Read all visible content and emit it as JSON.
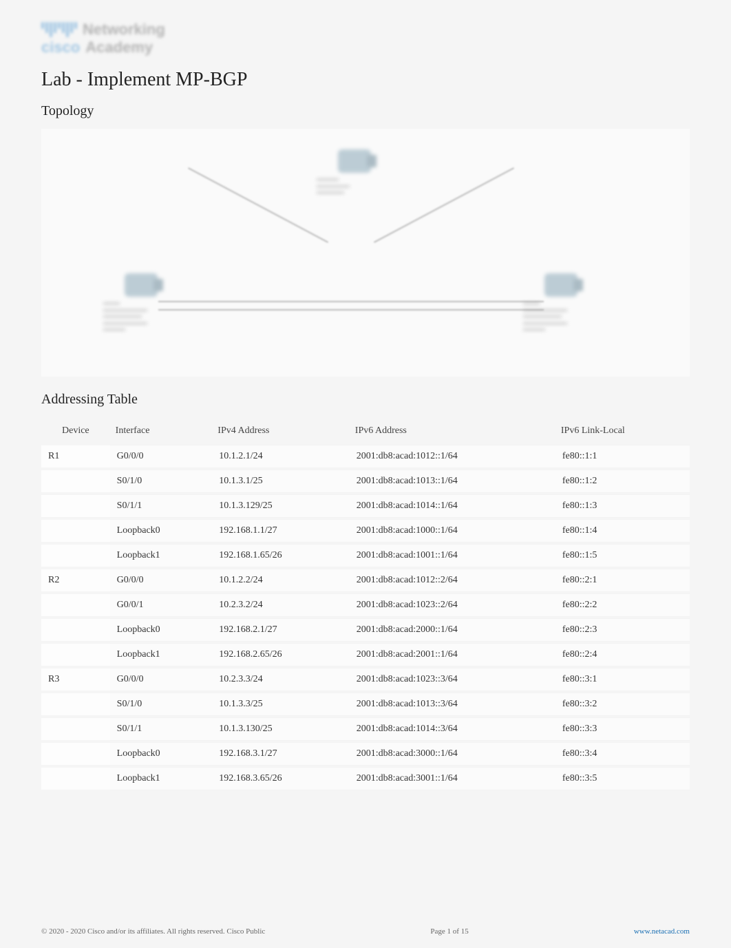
{
  "logo": {
    "brand": "cisco",
    "product_line1": "Networking",
    "product_line2": "Academy"
  },
  "lab_title": "Lab - Implement MP-BGP",
  "sections": {
    "topology": "Topology",
    "addressing_table": "Addressing Table"
  },
  "table": {
    "headers": {
      "device": "Device",
      "interface": "Interface",
      "ipv4": "IPv4 Address",
      "ipv6": "IPv6 Address",
      "ipv6_ll": "IPv6 Link-Local"
    },
    "rows": [
      {
        "device": "R1",
        "interface": "G0/0/0",
        "ipv4": "10.1.2.1/24",
        "ipv6": "2001:db8:acad:1012::1/64",
        "ll": "fe80::1:1"
      },
      {
        "device": "",
        "interface": "S0/1/0",
        "ipv4": "10.1.3.1/25",
        "ipv6": "2001:db8:acad:1013::1/64",
        "ll": "fe80::1:2"
      },
      {
        "device": "",
        "interface": "S0/1/1",
        "ipv4": "10.1.3.129/25",
        "ipv6": "2001:db8:acad:1014::1/64",
        "ll": "fe80::1:3"
      },
      {
        "device": "",
        "interface": "Loopback0",
        "ipv4": "192.168.1.1/27",
        "ipv6": "2001:db8:acad:1000::1/64",
        "ll": "fe80::1:4"
      },
      {
        "device": "",
        "interface": "Loopback1",
        "ipv4": "192.168.1.65/26",
        "ipv6": "2001:db8:acad:1001::1/64",
        "ll": "fe80::1:5"
      },
      {
        "device": "R2",
        "interface": "G0/0/0",
        "ipv4": "10.1.2.2/24",
        "ipv6": "2001:db8:acad:1012::2/64",
        "ll": "fe80::2:1"
      },
      {
        "device": "",
        "interface": "G0/0/1",
        "ipv4": "10.2.3.2/24",
        "ipv6": "2001:db8:acad:1023::2/64",
        "ll": "fe80::2:2"
      },
      {
        "device": "",
        "interface": "Loopback0",
        "ipv4": "192.168.2.1/27",
        "ipv6": "2001:db8:acad:2000::1/64",
        "ll": "fe80::2:3"
      },
      {
        "device": "",
        "interface": "Loopback1",
        "ipv4": "192.168.2.65/26",
        "ipv6": "2001:db8:acad:2001::1/64",
        "ll": "fe80::2:4"
      },
      {
        "device": "R3",
        "interface": "G0/0/0",
        "ipv4": "10.2.3.3/24",
        "ipv6": "2001:db8:acad:1023::3/64",
        "ll": "fe80::3:1"
      },
      {
        "device": "",
        "interface": "S0/1/0",
        "ipv4": "10.1.3.3/25",
        "ipv6": "2001:db8:acad:1013::3/64",
        "ll": "fe80::3:2"
      },
      {
        "device": "",
        "interface": "S0/1/1",
        "ipv4": "10.1.3.130/25",
        "ipv6": "2001:db8:acad:1014::3/64",
        "ll": "fe80::3:3"
      },
      {
        "device": "",
        "interface": "Loopback0",
        "ipv4": "192.168.3.1/27",
        "ipv6": "2001:db8:acad:3000::1/64",
        "ll": "fe80::3:4"
      },
      {
        "device": "",
        "interface": "Loopback1",
        "ipv4": "192.168.3.65/26",
        "ipv6": "2001:db8:acad:3001::1/64",
        "ll": "fe80::3:5"
      }
    ]
  },
  "footer": {
    "copyright": "© 2020 - 2020 Cisco and/or its affiliates. All rights reserved. Cisco Public",
    "page": "Page 1 of 15",
    "link": "www.netacad.com"
  }
}
